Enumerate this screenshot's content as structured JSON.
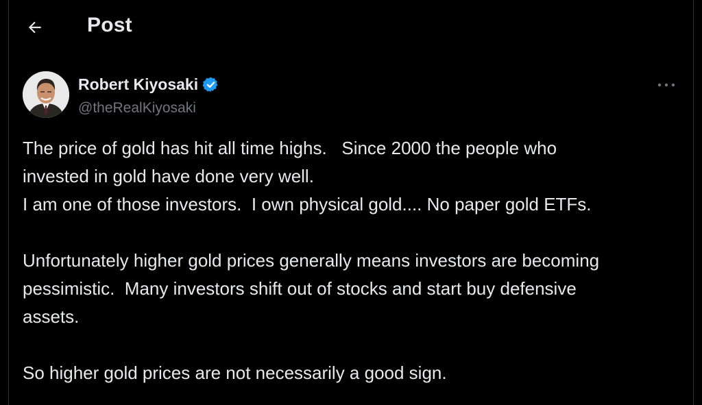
{
  "header": {
    "back_icon": "arrow-left-icon",
    "title": "Post"
  },
  "author": {
    "display_name": "Robert Kiyosaki",
    "handle": "@theRealKiyosaki",
    "verified_icon": "verified-badge-icon",
    "verified_color": "#1d9bf0",
    "more_icon": "more-horizontal-icon"
  },
  "post": {
    "paragraphs": [
      [
        "The price of gold has hit all time highs.   Since 2000 the people who",
        "invested in gold have done very well.",
        "I am one of those investors.  I own physical gold.... No paper gold ETFs."
      ],
      [
        "Unfortunately higher gold prices generally means investors are becoming",
        "pessimistic.  Many investors shift out of stocks and start buy defensive",
        "assets."
      ],
      [
        "So higher gold prices are not necessarily a good sign."
      ]
    ]
  },
  "colors": {
    "background": "#000000",
    "text_primary": "#e7e9ea",
    "text_secondary": "#71767b",
    "border": "#2f3336",
    "accent": "#1d9bf0"
  }
}
